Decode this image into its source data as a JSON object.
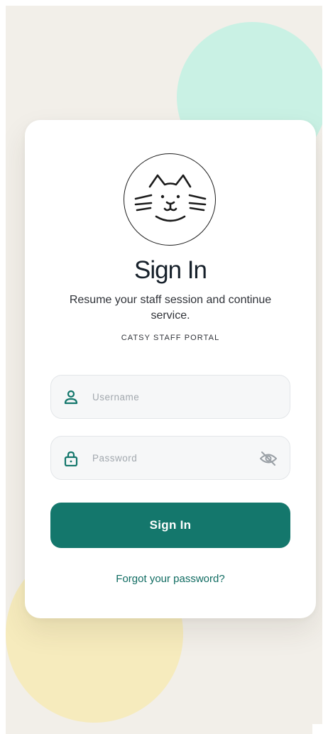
{
  "logo": {
    "icon": "cat-face-icon"
  },
  "heading": {
    "title": "Sign In"
  },
  "subtitle": "Resume your staff session and continue service.",
  "portal_label": "CATSY STAFF PORTAL",
  "username": {
    "icon": "user-icon",
    "placeholder": "Username",
    "value": ""
  },
  "password": {
    "icon": "lock-icon",
    "placeholder": "Password",
    "value": "",
    "toggle_icon": "eye-off-icon"
  },
  "sign_in_button": "Sign In",
  "forgot_link": "Forgot your password?",
  "colors": {
    "accent": "#14776c",
    "link": "#0f6b61",
    "background": "#f2efe9",
    "blob_teal": "#c9f1e4",
    "blob_yellow": "#f6ebbd"
  }
}
